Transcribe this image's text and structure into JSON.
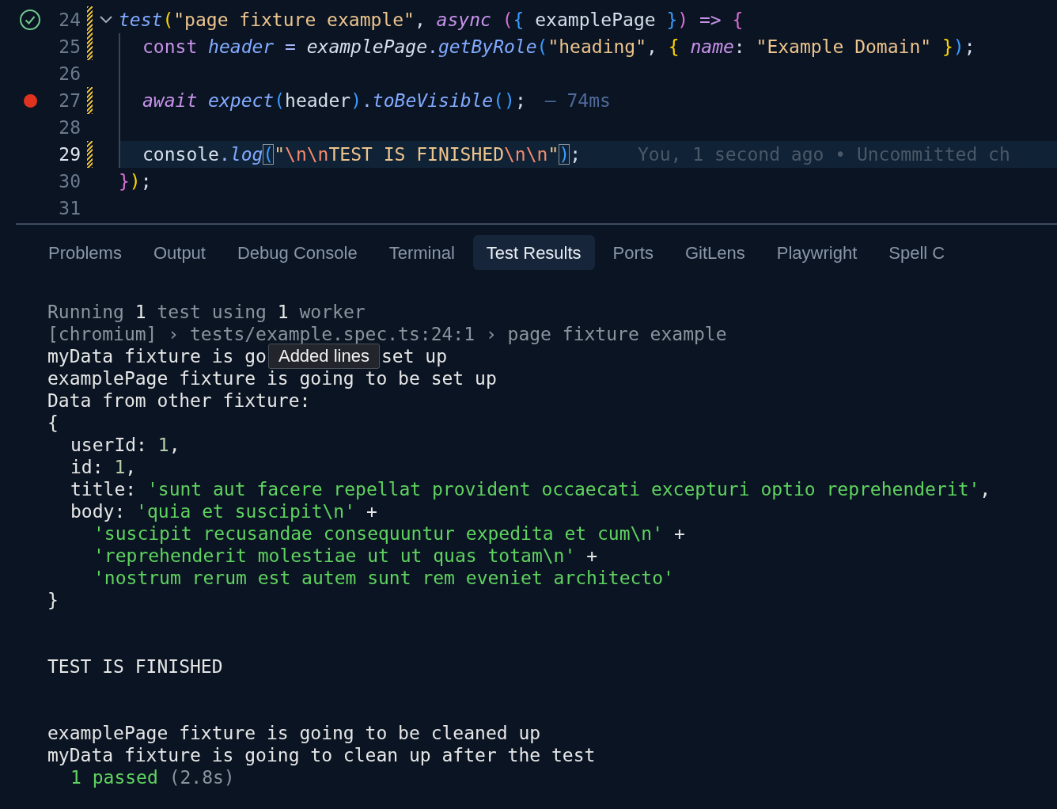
{
  "editor": {
    "lines": [
      {
        "number": "24",
        "test_passed": true,
        "breakpoint": false,
        "modified": true,
        "foldable": true,
        "current": false,
        "in_block": false,
        "tokens": [
          {
            "text": "test",
            "kind": "fn"
          },
          {
            "text": "(",
            "kind": "b1"
          },
          {
            "text": "\"page fixture example\"",
            "kind": "str"
          },
          {
            "text": ", ",
            "kind": "plain"
          },
          {
            "text": "async ",
            "kind": "kwi"
          },
          {
            "text": "(",
            "kind": "b2"
          },
          {
            "text": "{",
            "kind": "b3"
          },
          {
            "text": " examplePage ",
            "kind": "plain"
          },
          {
            "text": "}",
            "kind": "b3"
          },
          {
            "text": ")",
            "kind": "b2"
          },
          {
            "text": " => ",
            "kind": "kw"
          },
          {
            "text": "{",
            "kind": "b2"
          }
        ]
      },
      {
        "number": "25",
        "test_passed": false,
        "breakpoint": false,
        "modified": true,
        "foldable": false,
        "current": false,
        "in_block": true,
        "tokens": [
          {
            "text": "const ",
            "kind": "kw"
          },
          {
            "text": "header",
            "kind": "fn"
          },
          {
            "text": " = ",
            "kind": "op"
          },
          {
            "text": "examplePage",
            "kind": "plaini"
          },
          {
            "text": ".",
            "kind": "op"
          },
          {
            "text": "getByRole",
            "kind": "fn"
          },
          {
            "text": "(",
            "kind": "b3"
          },
          {
            "text": "\"heading\"",
            "kind": "str"
          },
          {
            "text": ", ",
            "kind": "plain"
          },
          {
            "text": "{ ",
            "kind": "b1"
          },
          {
            "text": "name",
            "kind": "kwi"
          },
          {
            "text": ": ",
            "kind": "plain"
          },
          {
            "text": "\"Example Domain\" ",
            "kind": "str"
          },
          {
            "text": "}",
            "kind": "b1"
          },
          {
            "text": ")",
            "kind": "b3"
          },
          {
            "text": ";",
            "kind": "plain"
          }
        ]
      },
      {
        "number": "26",
        "test_passed": false,
        "breakpoint": false,
        "modified": false,
        "foldable": false,
        "current": false,
        "in_block": true
      },
      {
        "number": "27",
        "test_passed": false,
        "breakpoint": true,
        "modified": true,
        "foldable": false,
        "current": false,
        "in_block": true,
        "tokens": [
          {
            "text": "await ",
            "kind": "kwi"
          },
          {
            "text": "expect",
            "kind": "fn"
          },
          {
            "text": "(",
            "kind": "b3"
          },
          {
            "text": "header",
            "kind": "plain"
          },
          {
            "text": ")",
            "kind": "b3"
          },
          {
            "text": ".",
            "kind": "op"
          },
          {
            "text": "toBeVisible",
            "kind": "fn"
          },
          {
            "text": "()",
            "kind": "b3"
          },
          {
            "text": ";",
            "kind": "plain"
          }
        ],
        "hint": {
          "kind": "duration",
          "text": "— 74ms"
        }
      },
      {
        "number": "28",
        "test_passed": false,
        "breakpoint": false,
        "modified": false,
        "foldable": false,
        "current": false,
        "in_block": true
      },
      {
        "number": "29",
        "test_passed": false,
        "breakpoint": false,
        "modified": true,
        "foldable": false,
        "current": true,
        "in_block": true,
        "tokens": [
          {
            "text": "console",
            "kind": "plain"
          },
          {
            "text": ".",
            "kind": "op"
          },
          {
            "text": "log",
            "kind": "fn"
          },
          {
            "text": "(",
            "kind": "bm"
          },
          {
            "text": "\"",
            "kind": "str"
          },
          {
            "text": "\\n\\n",
            "kind": "esc"
          },
          {
            "text": "TEST IS FINISHED",
            "kind": "str"
          },
          {
            "text": "\\n\\n",
            "kind": "esc"
          },
          {
            "text": "\"",
            "kind": "str"
          },
          {
            "text": ")",
            "kind": "bm"
          },
          {
            "text": ";",
            "kind": "plain"
          }
        ],
        "hint": {
          "kind": "blame",
          "text": "You, 1 second ago • Uncommitted ch"
        }
      },
      {
        "number": "30",
        "test_passed": false,
        "breakpoint": false,
        "modified": false,
        "foldable": false,
        "current": false,
        "in_block": false,
        "tokens": [
          {
            "text": "}",
            "kind": "b2"
          },
          {
            "text": ")",
            "kind": "b1"
          },
          {
            "text": ";",
            "kind": "plain"
          }
        ]
      },
      {
        "number": "31",
        "test_passed": false,
        "breakpoint": false,
        "modified": false,
        "foldable": false,
        "current": false,
        "in_block": false
      }
    ]
  },
  "panel": {
    "tabs": [
      {
        "label": "Problems",
        "selected": false
      },
      {
        "label": "Output",
        "selected": false
      },
      {
        "label": "Debug Console",
        "selected": false
      },
      {
        "label": "Terminal",
        "selected": false
      },
      {
        "label": "Test Results",
        "selected": true
      },
      {
        "label": "Ports",
        "selected": false
      },
      {
        "label": "GitLens",
        "selected": false
      },
      {
        "label": "Playwright",
        "selected": false
      },
      {
        "label": "Spell C",
        "selected": false
      }
    ],
    "output": [
      {
        "kind": "line",
        "segments": [
          {
            "text": "Running ",
            "kind": "dim"
          },
          {
            "text": "1",
            "kind": "text"
          },
          {
            "text": " test using ",
            "kind": "dim"
          },
          {
            "text": "1",
            "kind": "text"
          },
          {
            "text": " worker",
            "kind": "dim"
          }
        ]
      },
      {
        "kind": "line",
        "segments": [
          {
            "text": "[chromium] › tests/example.spec.ts:24:1 › page fixture example",
            "kind": "dim"
          }
        ]
      },
      {
        "kind": "line",
        "segments": [
          {
            "text": "myData fixture is go",
            "kind": "text"
          },
          {
            "text": "Added lines",
            "kind": "tooltip"
          },
          {
            "text": "set up",
            "kind": "text"
          }
        ]
      },
      {
        "kind": "line",
        "segments": [
          {
            "text": "examplePage fixture is going to be set up",
            "kind": "text"
          }
        ]
      },
      {
        "kind": "line",
        "segments": [
          {
            "text": "Data from other fixture:",
            "kind": "text"
          }
        ]
      },
      {
        "kind": "line",
        "segments": [
          {
            "text": "{",
            "kind": "text"
          }
        ]
      },
      {
        "kind": "property",
        "segments": [
          {
            "text": "userId: ",
            "kind": "text"
          },
          {
            "text": "1",
            "kind": "num"
          },
          {
            "text": ",",
            "kind": "text"
          }
        ]
      },
      {
        "kind": "property",
        "segments": [
          {
            "text": "id: ",
            "kind": "text"
          },
          {
            "text": "1",
            "kind": "num"
          },
          {
            "text": ",",
            "kind": "text"
          }
        ]
      },
      {
        "kind": "property",
        "segments": [
          {
            "text": "title: ",
            "kind": "text"
          },
          {
            "text": "'sunt aut facere repellat provident occaecati excepturi optio reprehenderit'",
            "kind": "str"
          },
          {
            "text": ",",
            "kind": "text"
          }
        ]
      },
      {
        "kind": "property",
        "segments": [
          {
            "text": "body: ",
            "kind": "text"
          },
          {
            "text": "'quia et suscipit\\n'",
            "kind": "str"
          },
          {
            "text": " +",
            "kind": "text"
          }
        ]
      },
      {
        "kind": "continuation",
        "segments": [
          {
            "text": "'suscipit recusandae consequuntur expedita et cum\\n'",
            "kind": "str"
          },
          {
            "text": " +",
            "kind": "text"
          }
        ]
      },
      {
        "kind": "continuation",
        "segments": [
          {
            "text": "'reprehenderit molestiae ut ut quas totam\\n'",
            "kind": "str"
          },
          {
            "text": " +",
            "kind": "text"
          }
        ]
      },
      {
        "kind": "continuation",
        "segments": [
          {
            "text": "'nostrum rerum est autem sunt rem eveniet architecto'",
            "kind": "str"
          }
        ]
      },
      {
        "kind": "line",
        "segments": [
          {
            "text": "}",
            "kind": "text"
          }
        ]
      },
      {
        "kind": "blank"
      },
      {
        "kind": "blank"
      },
      {
        "kind": "line",
        "segments": [
          {
            "text": "TEST IS FINISHED",
            "kind": "text"
          }
        ]
      },
      {
        "kind": "blank"
      },
      {
        "kind": "blank"
      },
      {
        "kind": "line",
        "segments": [
          {
            "text": "examplePage fixture is going to be cleaned up",
            "kind": "text"
          }
        ]
      },
      {
        "kind": "line",
        "segments": [
          {
            "text": "myData fixture is going to clean up after the test",
            "kind": "text"
          }
        ]
      },
      {
        "kind": "property",
        "segments": [
          {
            "text": "1 passed",
            "kind": "pass"
          },
          {
            "text": " (2.8s)",
            "kind": "dim"
          }
        ]
      }
    ]
  }
}
